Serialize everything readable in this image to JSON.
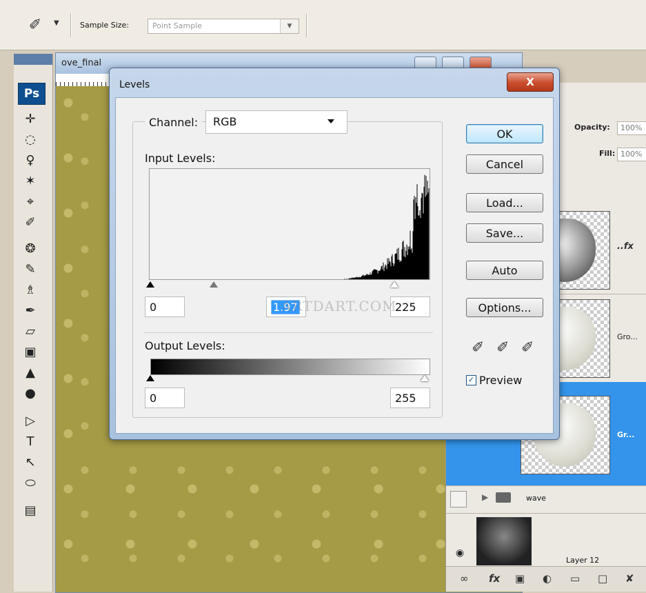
{
  "options_bar": {
    "sample_size_label": "Sample Size:",
    "sample_size_value": "Point Sample"
  },
  "toolbox": {
    "badge": "Ps"
  },
  "document": {
    "title": "ove_final"
  },
  "layers_panel": {
    "opacity_label": "Opacity:",
    "opacity_value": "100%",
    "fill_label": "Fill:",
    "fill_value": "100%",
    "fx_label": "..fx",
    "rows": [
      {
        "name": "Gro..."
      },
      {
        "name": "Gr..."
      },
      {
        "name": "wave"
      },
      {
        "name": "Layer 12"
      }
    ],
    "bottom_fx": "fx"
  },
  "levels_dialog": {
    "title": "Levels",
    "close_label": "X",
    "channel_label": "Channel:",
    "channel_value": "RGB",
    "input_levels_label": "Input Levels:",
    "input_black": "0",
    "input_gamma": "1.97",
    "input_white": "225",
    "output_levels_label": "Output Levels:",
    "output_black": "0",
    "output_white": "255",
    "buttons": {
      "ok": "OK",
      "cancel": "Cancel",
      "load": "Load...",
      "save": "Save...",
      "auto": "Auto",
      "options": "Options..."
    },
    "preview_label": "Preview",
    "preview_checked": true,
    "watermark": "ARTDART.COM"
  },
  "colors": {
    "accent": "#3494ec",
    "close_red": "#c94b2b",
    "canvas": "#a59a46"
  }
}
